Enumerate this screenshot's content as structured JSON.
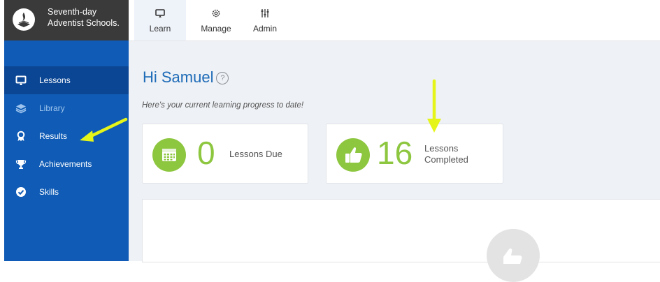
{
  "brand": {
    "name_line1": "Seventh-day",
    "name_line2": "Adventist Schools.",
    "logo_icon": "sda-flame-bible-logo"
  },
  "topnav": {
    "tabs": [
      {
        "label": "Learn",
        "icon": "monitor-icon",
        "active": true
      },
      {
        "label": "Manage",
        "icon": "gear-icon"
      },
      {
        "label": "Admin",
        "icon": "sliders-icon"
      }
    ]
  },
  "sidebar": {
    "items": [
      {
        "label": "Lessons",
        "icon": "monitor-icon",
        "active": true
      },
      {
        "label": "Library",
        "icon": "layers-icon"
      },
      {
        "label": "Results",
        "icon": "ribbon-icon"
      },
      {
        "label": "Achievements",
        "icon": "trophy-icon"
      },
      {
        "label": "Skills",
        "icon": "check-circle-icon"
      }
    ]
  },
  "main": {
    "greeting": "Hi Samuel",
    "help_icon": "question-circle-icon",
    "subtitle": "Here's your current learning progress to date!",
    "cards": [
      {
        "icon": "calendar-icon",
        "value": "0",
        "label_line1": "Lessons Due",
        "label_line2": ""
      },
      {
        "icon": "thumbs-up-icon",
        "value": "16",
        "label_line1": "Lessons",
        "label_line2": "Completed"
      }
    ]
  },
  "colors": {
    "sidebar": "#0f5bb5",
    "sidebar_active": "#0b4694",
    "brand_bg": "#3a3a3a",
    "accent_green": "#8dc63f",
    "greeting_blue": "#1e6bb8",
    "annotation_arrow": "#e5f51a"
  }
}
